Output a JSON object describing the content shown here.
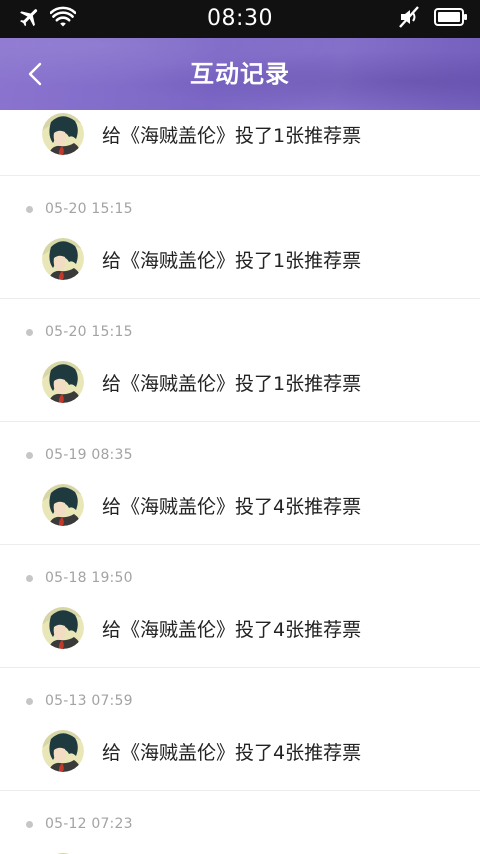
{
  "status_bar": {
    "time": "08:30",
    "icons": [
      "airplane-icon",
      "wifi-icon",
      "mute-icon",
      "battery-icon"
    ]
  },
  "header": {
    "title": "互动记录",
    "back_icon": "chevron-left-icon",
    "colors": {
      "accent": "#7c67c6",
      "background_dark": "#111111"
    }
  },
  "records": [
    {
      "time": "",
      "text": "给《海贼盖伦》投了1张推荐票"
    },
    {
      "time": "05-20 15:15",
      "text": "给《海贼盖伦》投了1张推荐票"
    },
    {
      "time": "05-20 15:15",
      "text": "给《海贼盖伦》投了1张推荐票"
    },
    {
      "time": "05-19 08:35",
      "text": "给《海贼盖伦》投了4张推荐票"
    },
    {
      "time": "05-18 19:50",
      "text": "给《海贼盖伦》投了4张推荐票"
    },
    {
      "time": "05-13 07:59",
      "text": "给《海贼盖伦》投了4张推荐票"
    },
    {
      "time": "05-12 07:23",
      "text": ""
    }
  ]
}
